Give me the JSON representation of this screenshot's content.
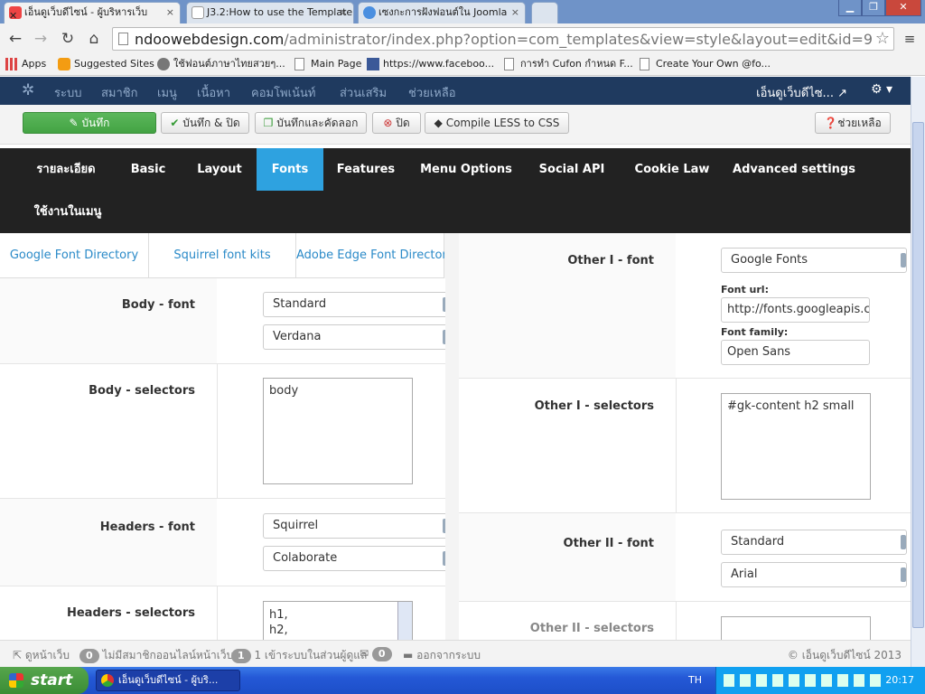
{
  "browser": {
    "tabs": [
      {
        "title": "เอ็นดูเว็บดีไซน์ - ผู้บริหารเว็บ",
        "close": "×"
      },
      {
        "title": "J3.2:How to use the Template",
        "close": "×"
      },
      {
        "title": "เซงกะการฝังฟอนต์ใน Joomla",
        "close": "×"
      }
    ],
    "url_host": "ndoowebdesign.com",
    "url_path": "/administrator/index.php?option=com_templates&view=style&layout=edit&id=9",
    "bookmarks": [
      "Apps",
      "Suggested Sites",
      "ใช้ฟอนต์ภาษาไทยสวยๆ...",
      "Main Page",
      "https://www.faceboo...",
      "การทำ Cufon กำหนด F...",
      "Create Your Own @fo..."
    ]
  },
  "joomla": {
    "menu": [
      "ระบบ",
      "สมาชิก",
      "เมนู",
      "เนื้อหา",
      "คอมโพเน้นท์",
      "ส่วนเสริม",
      "ช่วยเหลือ"
    ],
    "site_name": "เอ็นดูเว็บดีไซ...",
    "toolbar": {
      "save": "บันทึก",
      "save_close": "บันทึก & ปิด",
      "save_copy": "บันทึกและคัดลอก",
      "close": "ปิด",
      "compile": "Compile LESS to CSS",
      "help": "ช่วยเหลือ"
    },
    "tabs": [
      "รายละเอียด",
      "Basic",
      "Layout",
      "Fonts",
      "Features",
      "Menu Options",
      "Social API",
      "Cookie Law",
      "Advanced settings",
      "ใช้งานในเมนู"
    ],
    "active_tab": "Fonts",
    "subtabs": [
      "Google Font Directory",
      "Squirrel font kits",
      "Adobe Edge Font Directory"
    ]
  },
  "left": {
    "body_font_label": "Body - font",
    "body_font_type": "Standard",
    "body_font_value": "Verdana",
    "body_selectors_label": "Body - selectors",
    "body_selectors_value": "body",
    "headers_font_label": "Headers - font",
    "headers_font_type": "Squirrel",
    "headers_font_value": "Colaborate",
    "headers_selectors_label": "Headers - selectors",
    "headers_selectors_value": "h1,\nh2,"
  },
  "right": {
    "other1_font_label": "Other I - font",
    "other1_font_type": "Google Fonts",
    "font_url_label": "Font url:",
    "font_url_value": "http://fonts.googleapis.com",
    "font_family_label": "Font family:",
    "font_family_value": "Open Sans",
    "other1_selectors_label": "Other I - selectors",
    "other1_selectors_value": "#gk-content h2 small",
    "other2_font_label": "Other II - font",
    "other2_font_type": "Standard",
    "other2_font_value": "Arial",
    "other2_selectors_label": "Other II - selectors"
  },
  "status": {
    "view_site": "ดูหน้าเว็บ",
    "visitors_count": "0",
    "visitors_text": "ไม่มีสมาชิกออนไลน์หน้าเว็บ",
    "admins_count": "1",
    "admins_text": "1 เข้าระบบในส่วนผู้ดูแล",
    "messages_count": "0",
    "logout": "ออกจากระบบ",
    "copyright": "© เอ็นดูเว็บดีไซน์ 2013"
  },
  "taskbar": {
    "start": "start",
    "task_title": "เอ็นดูเว็บดีไซน์ - ผู้บริ...",
    "lang": "TH",
    "clock": "20:17"
  },
  "colors": {
    "joomla_nav": "#1f3a5f",
    "active_tab": "#2ea2e0",
    "save_green": "#5bb75b",
    "link_blue": "#2a8ac8"
  }
}
